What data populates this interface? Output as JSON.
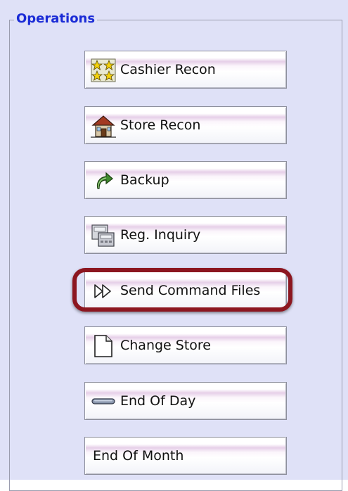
{
  "group": {
    "title": "Operations"
  },
  "buttons": [
    {
      "label": "Cashier Recon",
      "icon": "cashier-stars-icon"
    },
    {
      "label": "Store Recon",
      "icon": "store-house-icon"
    },
    {
      "label": "Backup",
      "icon": "backup-arrow-icon"
    },
    {
      "label": "Reg. Inquiry",
      "icon": "register-inquiry-icon"
    },
    {
      "label": "Send Command Files",
      "icon": "fast-forward-icon",
      "highlighted": true
    },
    {
      "label": "Change Store",
      "icon": "document-page-icon"
    },
    {
      "label": "End Of Day",
      "icon": "bar-icon"
    },
    {
      "label": "End Of Month",
      "icon": ""
    }
  ],
  "highlight_color": "#8c1620",
  "title_color": "#1a2bd6",
  "panel_color": "#dfe1f7"
}
